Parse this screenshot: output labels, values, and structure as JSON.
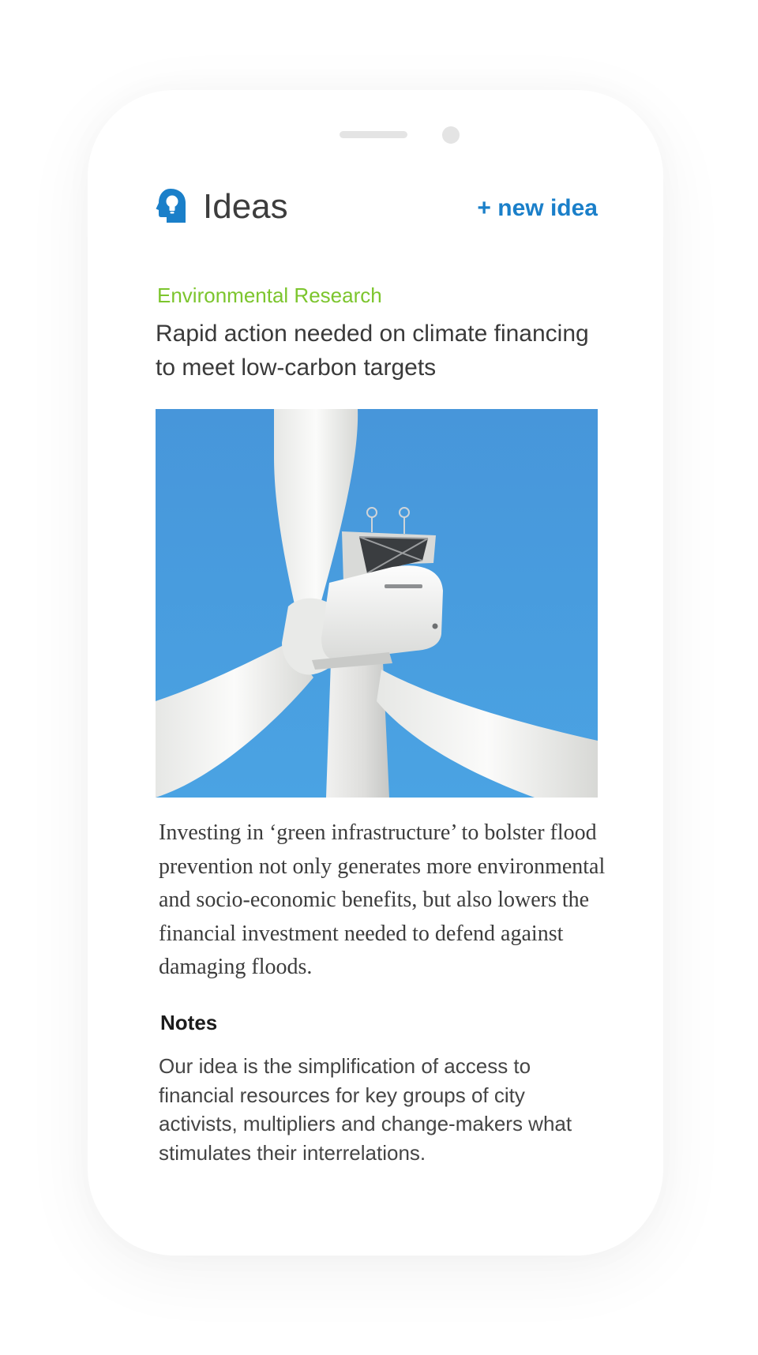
{
  "app": {
    "title": "Ideas",
    "logo_icon": "head-lightbulb-icon",
    "new_idea_label": "+ new idea"
  },
  "article": {
    "category": "Environmental Research",
    "title": "Rapid action needed on climate financing to meet low-carbon targets",
    "image_subject": "wind-turbine-photo",
    "body": "Investing in ‘green infrastructure’ to bolster flood prevention not only generates more environmental and socio-economic benefits, but also lowers the financial investment needed to defend against damaging floods."
  },
  "notes": {
    "heading": "Notes",
    "text": "Our idea is the simplification of access to financial resources for key groups of city activists, multipliers and change-makers what stimulates their interrelations."
  },
  "colors": {
    "accent_blue": "#1a7fc9",
    "category_green": "#7cc52d",
    "sky_blue": "#4a9ede"
  }
}
